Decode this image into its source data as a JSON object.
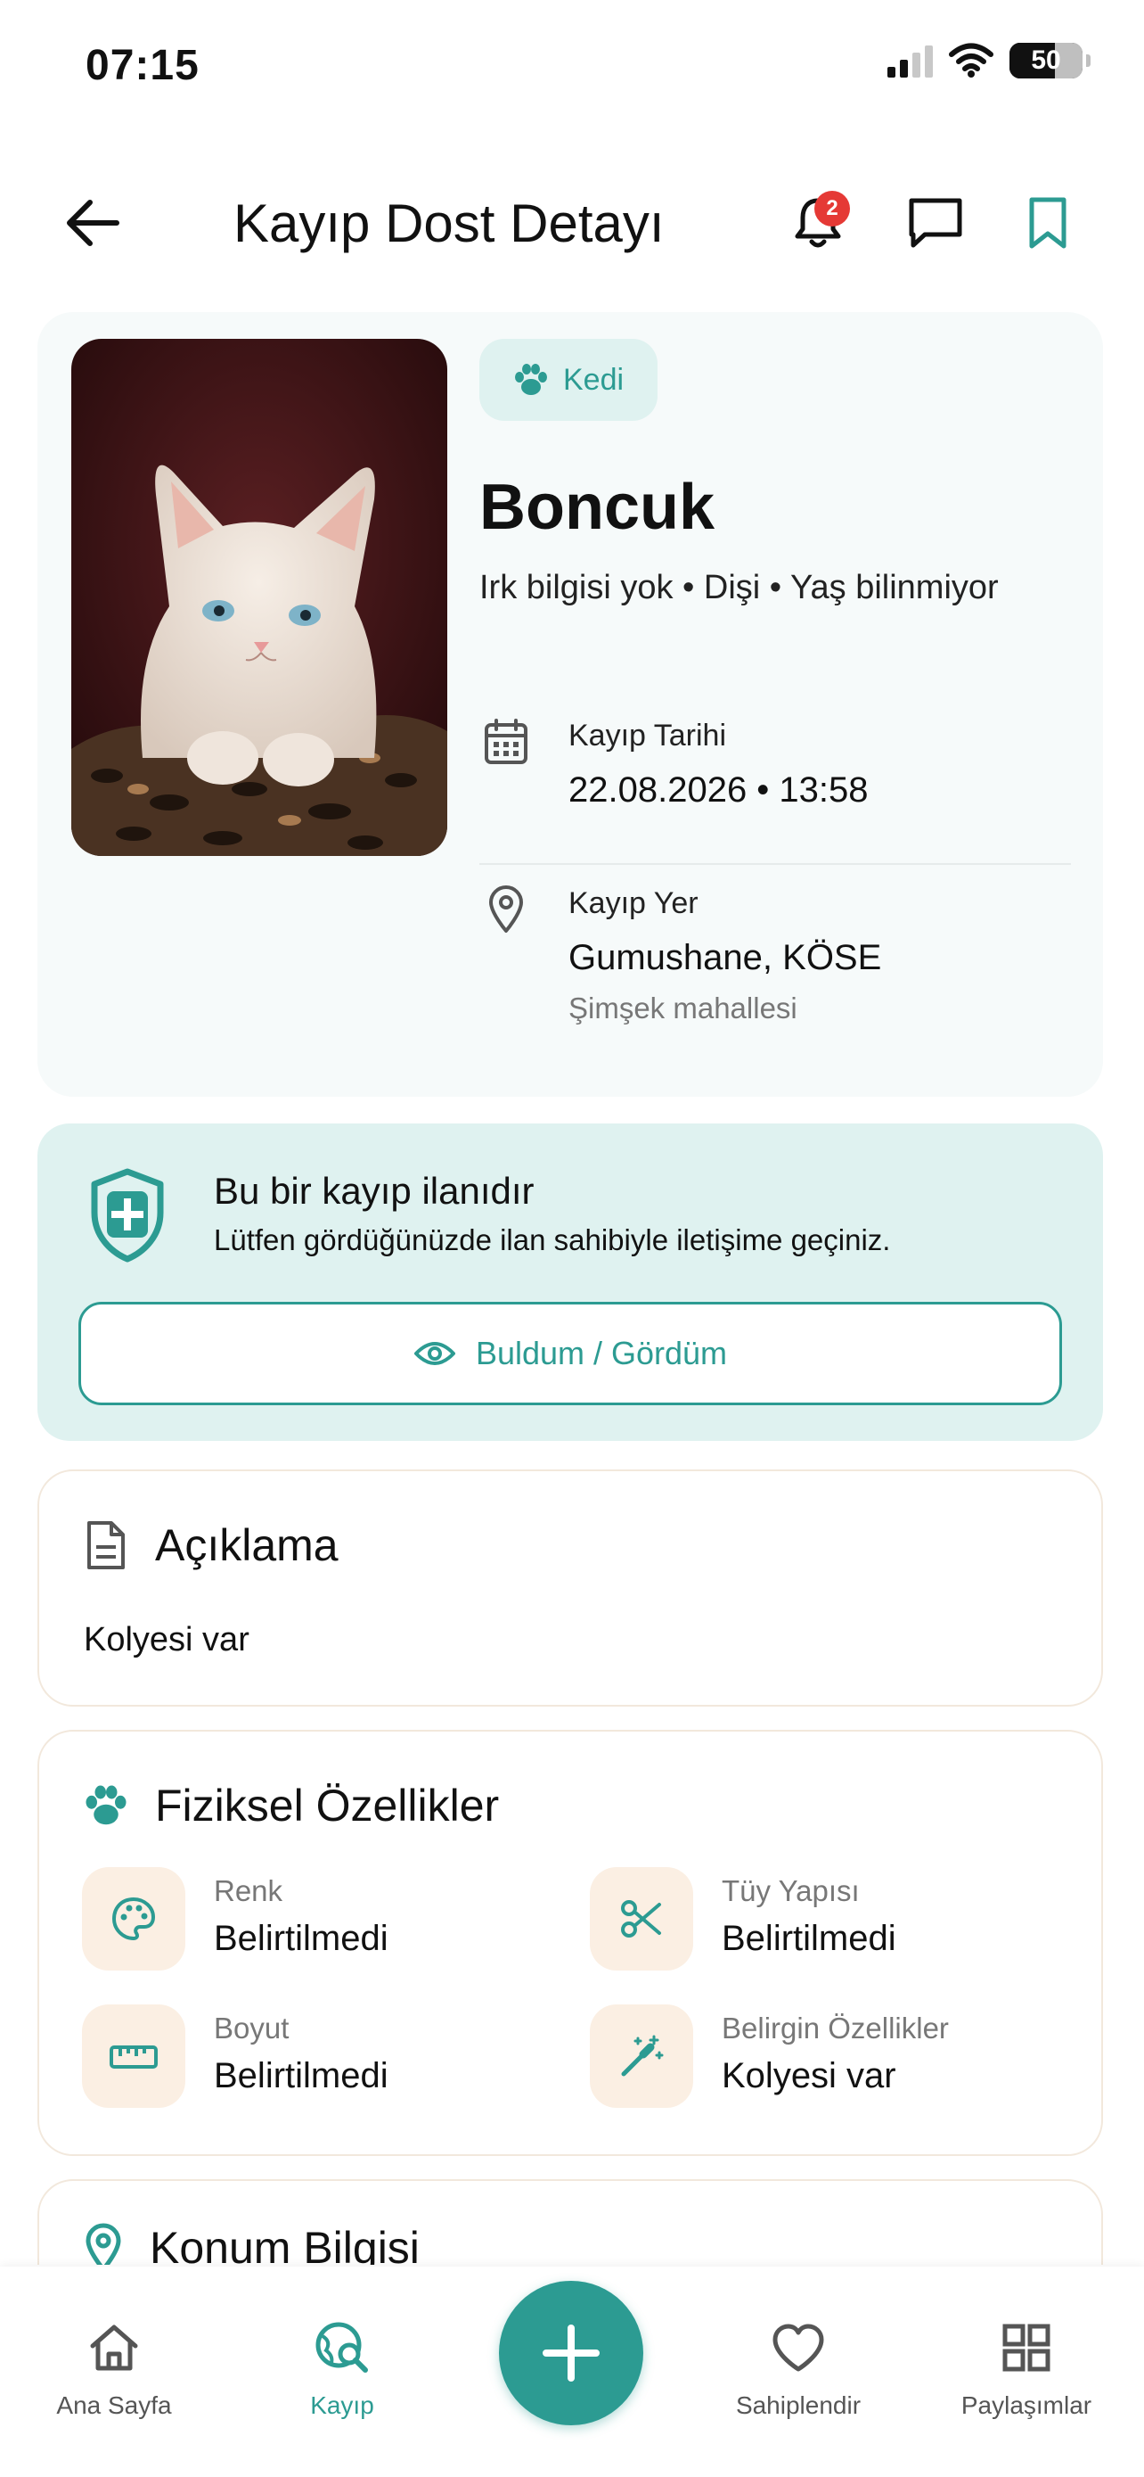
{
  "status_bar": {
    "time": "07:15",
    "battery": "50"
  },
  "header": {
    "title": "Kayıp Dost Detayı",
    "notification_count": "2",
    "back_icon": "arrow-left-icon",
    "bell_icon": "bell-icon",
    "chat_icon": "message-square-icon",
    "bookmark_icon": "bookmark-icon"
  },
  "pet": {
    "species": "Kedi",
    "name": "Boncuk",
    "meta": "Irk bilgisi yok  •  Dişi  •  Yaş bilinmiyor",
    "lost_date_label": "Kayıp Tarihi",
    "lost_date_value": "22.08.2026  •  13:58",
    "lost_place_label": "Kayıp Yer",
    "lost_place_value": "Gumushane, KÖSE",
    "lost_place_detail": "Şimşek mahallesi"
  },
  "alert": {
    "title": "Bu bir kayıp ilanıdır",
    "text": "Lütfen gördüğünüzde ilan sahibiyle iletişime geçiniz.",
    "button_label": "Buldum / Gördüm"
  },
  "description": {
    "title": "Açıklama",
    "text": "Kolyesi var"
  },
  "physical": {
    "title": "Fiziksel Özellikler",
    "items": [
      {
        "label": "Renk",
        "value": "Belirtilmedi",
        "icon": "palette-icon"
      },
      {
        "label": "Tüy Yapısı",
        "value": "Belirtilmedi",
        "icon": "scissors-icon"
      },
      {
        "label": "Boyut",
        "value": "Belirtilmedi",
        "icon": "ruler-icon"
      },
      {
        "label": "Belirgin Özellikler",
        "value": "Kolyesi var",
        "icon": "magic-wand-icon"
      }
    ]
  },
  "location": {
    "title": "Konum Bilgisi"
  },
  "bottom_nav": {
    "items": [
      {
        "label": "Ana Sayfa",
        "icon": "home-icon"
      },
      {
        "label": "Kayıp",
        "icon": "search-location-icon"
      },
      {
        "label": "Sahiplendir",
        "icon": "heart-icon"
      },
      {
        "label": "Paylaşımlar",
        "icon": "grid-icon"
      }
    ],
    "fab_icon": "plus-icon"
  },
  "colors": {
    "accent": "#2c9b92",
    "accent_light": "#dff2f0",
    "badge": "#e53935",
    "tile": "#fbefe3"
  }
}
